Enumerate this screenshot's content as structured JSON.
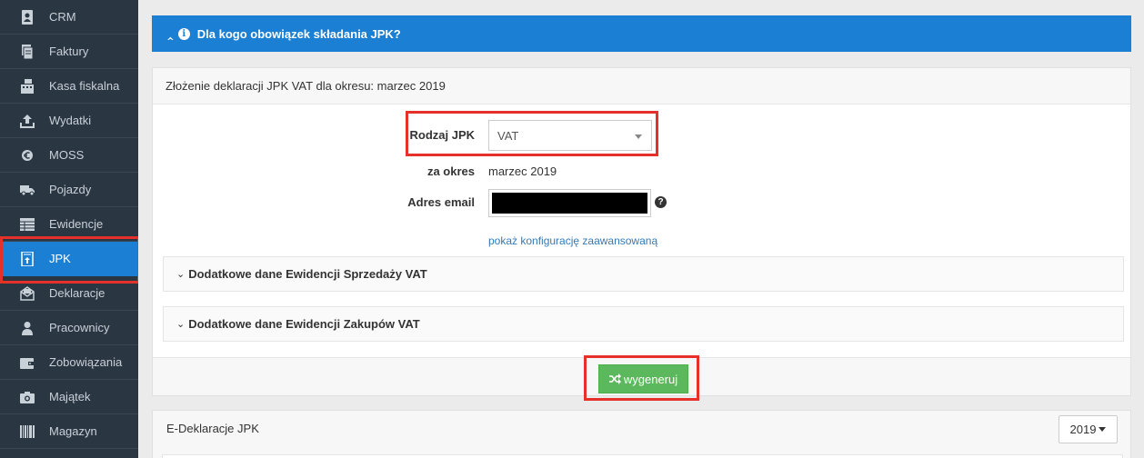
{
  "sidebar": {
    "items": [
      {
        "label": "CRM",
        "icon": "contact-book-icon"
      },
      {
        "label": "Faktury",
        "icon": "invoice-icon"
      },
      {
        "label": "Kasa fiskalna",
        "icon": "cash-register-icon"
      },
      {
        "label": "Wydatki",
        "icon": "upload-icon"
      },
      {
        "label": "MOSS",
        "icon": "euro-coin-icon"
      },
      {
        "label": "Pojazdy",
        "icon": "truck-icon"
      },
      {
        "label": "Ewidencje",
        "icon": "table-icon"
      },
      {
        "label": "JPK",
        "icon": "jpk-file-icon",
        "active": true
      },
      {
        "label": "Deklaracje",
        "icon": "envelope-icon"
      },
      {
        "label": "Pracownicy",
        "icon": "person-icon"
      },
      {
        "label": "Zobowiązania",
        "icon": "wallet-icon"
      },
      {
        "label": "Majątek",
        "icon": "camera-icon"
      },
      {
        "label": "Magazyn",
        "icon": "barcode-icon"
      }
    ]
  },
  "info_bar": {
    "title": "Dla kogo obowiązek składania JPK?"
  },
  "declaration_panel": {
    "title": "Złożenie deklaracji JPK VAT dla okresu: marzec 2019",
    "jpk_type": {
      "label": "Rodzaj JPK",
      "value": "VAT"
    },
    "period": {
      "label": "za okres",
      "value": "marzec 2019"
    },
    "email": {
      "label": "Adres email",
      "value": ""
    },
    "advanced_link": "pokaż konfigurację zaawansowaną",
    "sales_section": "Dodatkowe dane Ewidencji Sprzedaży VAT",
    "purchase_section": "Dodatkowe dane Ewidencji Zakupów VAT",
    "generate_button": "wygeneruj"
  },
  "edeklaracje_panel": {
    "title": "E-Deklaracje JPK",
    "year": "2019"
  },
  "colors": {
    "sidebar_bg": "#2b3643",
    "accent_blue": "#1b7fd3",
    "button_green": "#5cb85c",
    "highlight_red": "#e5312a"
  }
}
